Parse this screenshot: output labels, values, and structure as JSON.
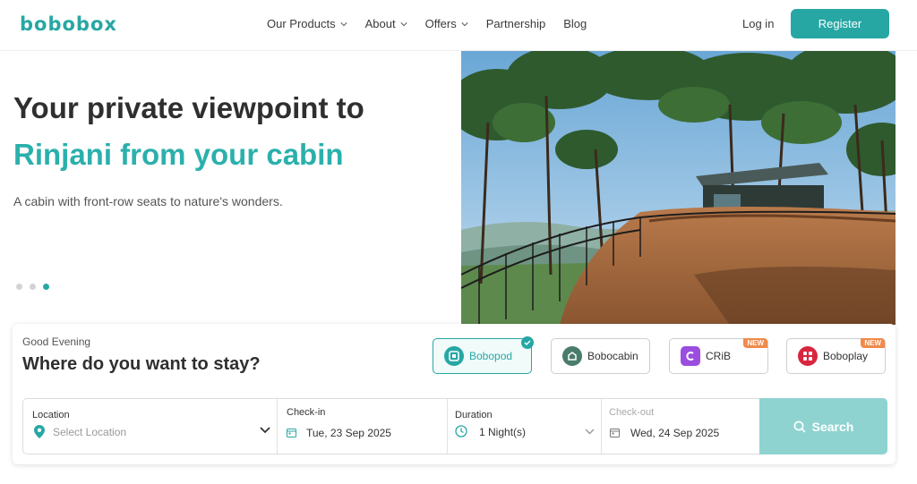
{
  "brand": {
    "logo": "bobobox",
    "accent": "#27a7a4"
  },
  "nav": {
    "items": [
      {
        "label": "Our Products",
        "has_dropdown": true
      },
      {
        "label": "About",
        "has_dropdown": true
      },
      {
        "label": "Offers",
        "has_dropdown": true
      },
      {
        "label": "Partnership",
        "has_dropdown": false
      },
      {
        "label": "Blog",
        "has_dropdown": false
      }
    ],
    "login": "Log in",
    "register": "Register"
  },
  "hero": {
    "title": "Your private viewpoint to",
    "subtitle": "Rinjani from your cabin",
    "description": "A cabin with front-row seats to nature's wonders.",
    "carousel_active_index": 2,
    "carousel_count": 3
  },
  "booking": {
    "greeting": "Good Evening",
    "question": "Where do you want to stay?",
    "products": [
      {
        "name": "Bobopod",
        "selected": true,
        "badge": "",
        "color": "#27a7a4",
        "icon": "bobopod-icon"
      },
      {
        "name": "Bobocabin",
        "selected": false,
        "badge": "",
        "color": "#4a7c6b",
        "icon": "bobocabin-icon"
      },
      {
        "name": "CRiB",
        "selected": false,
        "badge": "NEW",
        "color": "#9b4de0",
        "icon": "crib-icon"
      },
      {
        "name": "Boboplay",
        "selected": false,
        "badge": "NEW",
        "color": "#d9263f",
        "icon": "boboplay-icon"
      }
    ],
    "location": {
      "label": "Location",
      "placeholder": "Select Location"
    },
    "checkin": {
      "label": "Check-in",
      "value": "Tue, 23 Sep 2025"
    },
    "duration": {
      "label": "Duration",
      "value": "1 Night(s)"
    },
    "checkout": {
      "label": "Check-out",
      "value": "Wed, 24 Sep 2025"
    },
    "search_label": "Search"
  }
}
